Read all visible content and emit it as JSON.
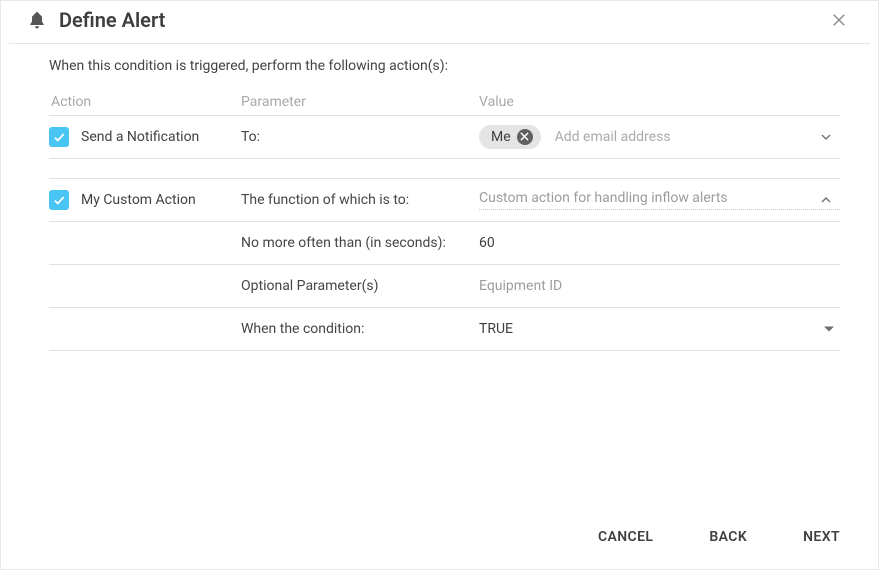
{
  "header": {
    "title": "Define Alert"
  },
  "instruction": "When this condition is triggered, perform the following action(s):",
  "columns": {
    "action": "Action",
    "parameter": "Parameter",
    "value": "Value"
  },
  "actions": {
    "notification": {
      "label": "Send a Notification",
      "to_label": "To:",
      "chip": "Me",
      "email_placeholder": "Add email address"
    },
    "custom": {
      "label": "My Custom Action",
      "function_label": "The function of which is to:",
      "function_value": "Custom action for handling inflow alerts",
      "rate_label": "No more often than (in seconds):",
      "rate_value": "60",
      "optional_label": "Optional Parameter(s)",
      "optional_value": "Equipment ID",
      "when_label": "When the condition:",
      "when_value": "TRUE"
    }
  },
  "footer": {
    "cancel": "CANCEL",
    "back": "BACK",
    "next": "NEXT"
  }
}
